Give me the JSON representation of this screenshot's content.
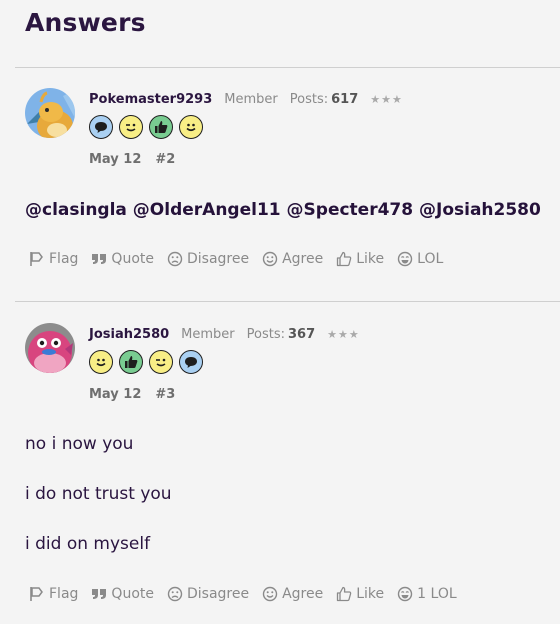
{
  "section": {
    "title": "Answers"
  },
  "posts": [
    {
      "username": "Pokemaster9293",
      "role": "Member",
      "posts_label": "Posts:",
      "posts_count": "617",
      "stars": "★★★",
      "badges": [
        "speech-bubble-icon",
        "wink-face-icon",
        "thumbs-up-icon",
        "happy-face-icon"
      ],
      "date": "May 12",
      "number": "#2",
      "body_lines": [
        "@clasingla @OlderAngel11 @Specter478 @Josiah2580"
      ],
      "actions": {
        "flag": "Flag",
        "quote": "Quote",
        "disagree": "Disagree",
        "agree": "Agree",
        "like": "Like",
        "lol": "LOL"
      }
    },
    {
      "username": "Josiah2580",
      "role": "Member",
      "posts_label": "Posts:",
      "posts_count": "367",
      "stars": "★★★",
      "badges": [
        "happy-face-icon",
        "thumbs-up-icon",
        "wink-face-icon",
        "speech-bubble-icon"
      ],
      "date": "May 12",
      "number": "#3",
      "body_lines": [
        "no i now you",
        "i do not trust you",
        "i did on myself"
      ],
      "actions": {
        "flag": "Flag",
        "quote": "Quote",
        "disagree": "Disagree",
        "agree": "Agree",
        "like": "Like",
        "lol": "1 LOL"
      }
    }
  ],
  "colors": {
    "badge_speech": "#aad0f2",
    "badge_face": "#f8ee86",
    "badge_thumb": "#79cc91",
    "title": "#2b1640",
    "divider": "#cfcfcf"
  }
}
